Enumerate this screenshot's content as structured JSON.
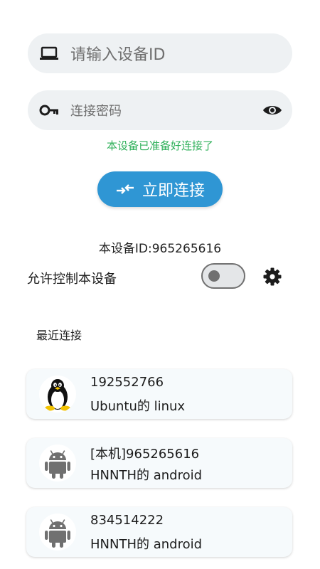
{
  "device_id_input": {
    "placeholder": "请输入设备ID"
  },
  "password_input": {
    "placeholder": "连接密码"
  },
  "status_text": "本设备已准备好连接了",
  "connect_button": {
    "label": "立即连接"
  },
  "local_device": {
    "id_text": "本设备ID:965265616"
  },
  "allow_control": {
    "label": "允许控制本设备",
    "enabled": false
  },
  "recent": {
    "title": "最近连接",
    "items": [
      {
        "id": "192552766",
        "desc": "Ubuntu的 linux",
        "icon": "linux-penguin-icon"
      },
      {
        "id": "[本机]965265616",
        "desc": "HNNTH的 android",
        "icon": "android-icon"
      },
      {
        "id": "834514222",
        "desc": "HNNTH的 android",
        "icon": "android-icon"
      }
    ]
  },
  "colors": {
    "accent": "#2f96d4",
    "status_green": "#2fb05a",
    "field_bg": "#eef1f3",
    "card_bg": "#f6fafc"
  }
}
